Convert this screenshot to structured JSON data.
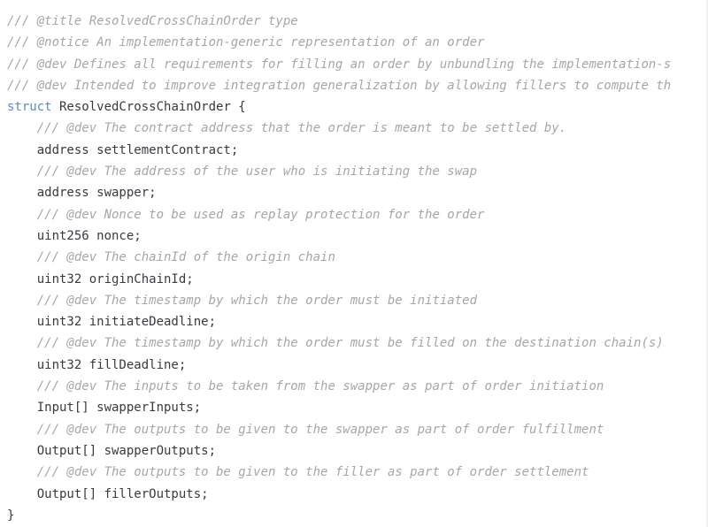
{
  "viewer": {
    "name": "solidity-code-snippet",
    "language": "solidity",
    "background_color": "#ffffff",
    "text_color": "#383a42",
    "comment_color": "#a5a6ad",
    "keyword_color": "#5b8ac7",
    "border_color": "#f1f1f3"
  },
  "code": {
    "lines": [
      {
        "indent": "",
        "comment": "/// @title ResolvedCrossChainOrder type",
        "keyword": "",
        "rest": ""
      },
      {
        "indent": "",
        "comment": "/// @notice An implementation-generic representation of an order",
        "keyword": "",
        "rest": ""
      },
      {
        "indent": "",
        "comment": "/// @dev Defines all requirements for filling an order by unbundling the implementation-s",
        "keyword": "",
        "rest": ""
      },
      {
        "indent": "",
        "comment": "/// @dev Intended to improve integration generalization by allowing fillers to compute th",
        "keyword": "",
        "rest": ""
      },
      {
        "indent": "",
        "comment": "",
        "keyword": "struct",
        "rest": " ResolvedCrossChainOrder {"
      },
      {
        "indent": "    ",
        "comment": "/// @dev The contract address that the order is meant to be settled by.",
        "keyword": "",
        "rest": ""
      },
      {
        "indent": "    ",
        "comment": "",
        "keyword": "",
        "rest": "address settlementContract;"
      },
      {
        "indent": "    ",
        "comment": "/// @dev The address of the user who is initiating the swap",
        "keyword": "",
        "rest": ""
      },
      {
        "indent": "    ",
        "comment": "",
        "keyword": "",
        "rest": "address swapper;"
      },
      {
        "indent": "    ",
        "comment": "/// @dev Nonce to be used as replay protection for the order",
        "keyword": "",
        "rest": ""
      },
      {
        "indent": "    ",
        "comment": "",
        "keyword": "",
        "rest": "uint256 nonce;"
      },
      {
        "indent": "    ",
        "comment": "/// @dev The chainId of the origin chain",
        "keyword": "",
        "rest": ""
      },
      {
        "indent": "    ",
        "comment": "",
        "keyword": "",
        "rest": "uint32 originChainId;"
      },
      {
        "indent": "    ",
        "comment": "/// @dev The timestamp by which the order must be initiated",
        "keyword": "",
        "rest": ""
      },
      {
        "indent": "    ",
        "comment": "",
        "keyword": "",
        "rest": "uint32 initiateDeadline;"
      },
      {
        "indent": "    ",
        "comment": "/// @dev The timestamp by which the order must be filled on the destination chain(s)",
        "keyword": "",
        "rest": ""
      },
      {
        "indent": "    ",
        "comment": "",
        "keyword": "",
        "rest": "uint32 fillDeadline;"
      },
      {
        "indent": "    ",
        "comment": "/// @dev The inputs to be taken from the swapper as part of order initiation",
        "keyword": "",
        "rest": ""
      },
      {
        "indent": "    ",
        "comment": "",
        "keyword": "",
        "rest": "Input[] swapperInputs;"
      },
      {
        "indent": "    ",
        "comment": "/// @dev The outputs to be given to the swapper as part of order fulfillment",
        "keyword": "",
        "rest": ""
      },
      {
        "indent": "    ",
        "comment": "",
        "keyword": "",
        "rest": "Output[] swapperOutputs;"
      },
      {
        "indent": "    ",
        "comment": "/// @dev The outputs to be given to the filler as part of order settlement",
        "keyword": "",
        "rest": ""
      },
      {
        "indent": "    ",
        "comment": "",
        "keyword": "",
        "rest": "Output[] fillerOutputs;"
      },
      {
        "indent": "",
        "comment": "",
        "keyword": "",
        "rest": "}"
      }
    ]
  }
}
